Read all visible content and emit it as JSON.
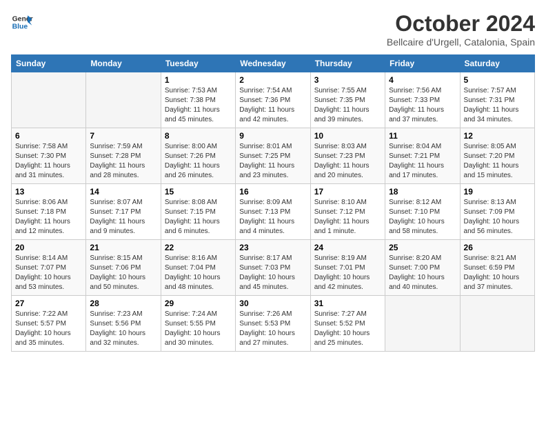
{
  "header": {
    "logo_line1": "General",
    "logo_line2": "Blue",
    "month": "October 2024",
    "location": "Bellcaire d'Urgell, Catalonia, Spain"
  },
  "weekdays": [
    "Sunday",
    "Monday",
    "Tuesday",
    "Wednesday",
    "Thursday",
    "Friday",
    "Saturday"
  ],
  "weeks": [
    [
      {
        "day": "",
        "info": ""
      },
      {
        "day": "",
        "info": ""
      },
      {
        "day": "1",
        "info": "Sunrise: 7:53 AM\nSunset: 7:38 PM\nDaylight: 11 hours and 45 minutes."
      },
      {
        "day": "2",
        "info": "Sunrise: 7:54 AM\nSunset: 7:36 PM\nDaylight: 11 hours and 42 minutes."
      },
      {
        "day": "3",
        "info": "Sunrise: 7:55 AM\nSunset: 7:35 PM\nDaylight: 11 hours and 39 minutes."
      },
      {
        "day": "4",
        "info": "Sunrise: 7:56 AM\nSunset: 7:33 PM\nDaylight: 11 hours and 37 minutes."
      },
      {
        "day": "5",
        "info": "Sunrise: 7:57 AM\nSunset: 7:31 PM\nDaylight: 11 hours and 34 minutes."
      }
    ],
    [
      {
        "day": "6",
        "info": "Sunrise: 7:58 AM\nSunset: 7:30 PM\nDaylight: 11 hours and 31 minutes."
      },
      {
        "day": "7",
        "info": "Sunrise: 7:59 AM\nSunset: 7:28 PM\nDaylight: 11 hours and 28 minutes."
      },
      {
        "day": "8",
        "info": "Sunrise: 8:00 AM\nSunset: 7:26 PM\nDaylight: 11 hours and 26 minutes."
      },
      {
        "day": "9",
        "info": "Sunrise: 8:01 AM\nSunset: 7:25 PM\nDaylight: 11 hours and 23 minutes."
      },
      {
        "day": "10",
        "info": "Sunrise: 8:03 AM\nSunset: 7:23 PM\nDaylight: 11 hours and 20 minutes."
      },
      {
        "day": "11",
        "info": "Sunrise: 8:04 AM\nSunset: 7:21 PM\nDaylight: 11 hours and 17 minutes."
      },
      {
        "day": "12",
        "info": "Sunrise: 8:05 AM\nSunset: 7:20 PM\nDaylight: 11 hours and 15 minutes."
      }
    ],
    [
      {
        "day": "13",
        "info": "Sunrise: 8:06 AM\nSunset: 7:18 PM\nDaylight: 11 hours and 12 minutes."
      },
      {
        "day": "14",
        "info": "Sunrise: 8:07 AM\nSunset: 7:17 PM\nDaylight: 11 hours and 9 minutes."
      },
      {
        "day": "15",
        "info": "Sunrise: 8:08 AM\nSunset: 7:15 PM\nDaylight: 11 hours and 6 minutes."
      },
      {
        "day": "16",
        "info": "Sunrise: 8:09 AM\nSunset: 7:13 PM\nDaylight: 11 hours and 4 minutes."
      },
      {
        "day": "17",
        "info": "Sunrise: 8:10 AM\nSunset: 7:12 PM\nDaylight: 11 hours and 1 minute."
      },
      {
        "day": "18",
        "info": "Sunrise: 8:12 AM\nSunset: 7:10 PM\nDaylight: 10 hours and 58 minutes."
      },
      {
        "day": "19",
        "info": "Sunrise: 8:13 AM\nSunset: 7:09 PM\nDaylight: 10 hours and 56 minutes."
      }
    ],
    [
      {
        "day": "20",
        "info": "Sunrise: 8:14 AM\nSunset: 7:07 PM\nDaylight: 10 hours and 53 minutes."
      },
      {
        "day": "21",
        "info": "Sunrise: 8:15 AM\nSunset: 7:06 PM\nDaylight: 10 hours and 50 minutes."
      },
      {
        "day": "22",
        "info": "Sunrise: 8:16 AM\nSunset: 7:04 PM\nDaylight: 10 hours and 48 minutes."
      },
      {
        "day": "23",
        "info": "Sunrise: 8:17 AM\nSunset: 7:03 PM\nDaylight: 10 hours and 45 minutes."
      },
      {
        "day": "24",
        "info": "Sunrise: 8:19 AM\nSunset: 7:01 PM\nDaylight: 10 hours and 42 minutes."
      },
      {
        "day": "25",
        "info": "Sunrise: 8:20 AM\nSunset: 7:00 PM\nDaylight: 10 hours and 40 minutes."
      },
      {
        "day": "26",
        "info": "Sunrise: 8:21 AM\nSunset: 6:59 PM\nDaylight: 10 hours and 37 minutes."
      }
    ],
    [
      {
        "day": "27",
        "info": "Sunrise: 7:22 AM\nSunset: 5:57 PM\nDaylight: 10 hours and 35 minutes."
      },
      {
        "day": "28",
        "info": "Sunrise: 7:23 AM\nSunset: 5:56 PM\nDaylight: 10 hours and 32 minutes."
      },
      {
        "day": "29",
        "info": "Sunrise: 7:24 AM\nSunset: 5:55 PM\nDaylight: 10 hours and 30 minutes."
      },
      {
        "day": "30",
        "info": "Sunrise: 7:26 AM\nSunset: 5:53 PM\nDaylight: 10 hours and 27 minutes."
      },
      {
        "day": "31",
        "info": "Sunrise: 7:27 AM\nSunset: 5:52 PM\nDaylight: 10 hours and 25 minutes."
      },
      {
        "day": "",
        "info": ""
      },
      {
        "day": "",
        "info": ""
      }
    ]
  ]
}
